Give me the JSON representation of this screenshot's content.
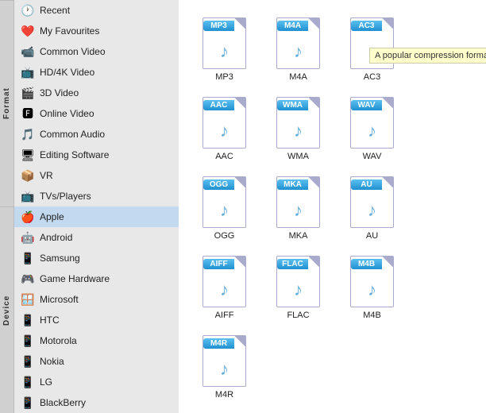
{
  "sidebar": {
    "format_label": "Format",
    "device_label": "Device",
    "items": [
      {
        "id": "recent",
        "label": "Recent",
        "icon": "🕐",
        "color": "#555"
      },
      {
        "id": "my-favourites",
        "label": "My Favourites",
        "icon": "❤️",
        "color": "#e44"
      },
      {
        "id": "common-video",
        "label": "Common Video",
        "icon": "📹",
        "color": "#555"
      },
      {
        "id": "hd-4k-video",
        "label": "HD/4K Video",
        "icon": "📺",
        "color": "#555"
      },
      {
        "id": "3d-video",
        "label": "3D Video",
        "icon": "🎬",
        "color": "#555"
      },
      {
        "id": "online-video",
        "label": "Online Video",
        "icon": "🅵",
        "color": "#e44"
      },
      {
        "id": "common-audio",
        "label": "Common Audio",
        "icon": "🎵",
        "color": "#555"
      },
      {
        "id": "editing-software",
        "label": "Editing Software",
        "icon": "🖥",
        "color": "#555"
      },
      {
        "id": "vr",
        "label": "VR",
        "icon": "📦",
        "color": "#555"
      },
      {
        "id": "tvs-players",
        "label": "TVs/Players",
        "icon": "📺",
        "color": "#555"
      },
      {
        "id": "apple",
        "label": "Apple",
        "icon": "🍎",
        "color": "#777",
        "selected": true
      },
      {
        "id": "android",
        "label": "Android",
        "icon": "🤖",
        "color": "#78c257"
      },
      {
        "id": "samsung",
        "label": "Samsung",
        "icon": "📱",
        "color": "#555"
      },
      {
        "id": "game-hardware",
        "label": "Game Hardware",
        "icon": "🎮",
        "color": "#555"
      },
      {
        "id": "microsoft",
        "label": "Microsoft",
        "icon": "🪟",
        "color": "#555"
      },
      {
        "id": "htc",
        "label": "HTC",
        "icon": "📱",
        "color": "#555"
      },
      {
        "id": "motorola",
        "label": "Motorola",
        "icon": "📱",
        "color": "#555"
      },
      {
        "id": "nokia",
        "label": "Nokia",
        "icon": "📱",
        "color": "#555"
      },
      {
        "id": "lg",
        "label": "LG",
        "icon": "📱",
        "color": "#c00"
      },
      {
        "id": "blackberry",
        "label": "BlackBerry",
        "icon": "📱",
        "color": "#555"
      }
    ]
  },
  "formats": {
    "tooltip": "A popular compression format used for audio fi...",
    "items": [
      {
        "id": "mp3",
        "label": "MP3",
        "badge": "MP3",
        "highlighted": true
      },
      {
        "id": "m4a",
        "label": "M4A",
        "badge": "M4A"
      },
      {
        "id": "ac3",
        "label": "AC3",
        "badge": "AC3"
      },
      {
        "id": "aac",
        "label": "AAC",
        "badge": "AAC"
      },
      {
        "id": "wma",
        "label": "WMA",
        "badge": "WMA"
      },
      {
        "id": "wav",
        "label": "WAV",
        "badge": "WAV"
      },
      {
        "id": "ogg",
        "label": "OGG",
        "badge": "OGG"
      },
      {
        "id": "mka",
        "label": "MKA",
        "badge": "MKA"
      },
      {
        "id": "au",
        "label": "AU",
        "badge": "AU"
      },
      {
        "id": "aiff",
        "label": "AIFF",
        "badge": "AIFF"
      },
      {
        "id": "flac",
        "label": "FLAC",
        "badge": "FLAC"
      },
      {
        "id": "m4b",
        "label": "M4B",
        "badge": "M4B"
      },
      {
        "id": "m4r",
        "label": "M4R",
        "badge": "M4R"
      }
    ]
  }
}
